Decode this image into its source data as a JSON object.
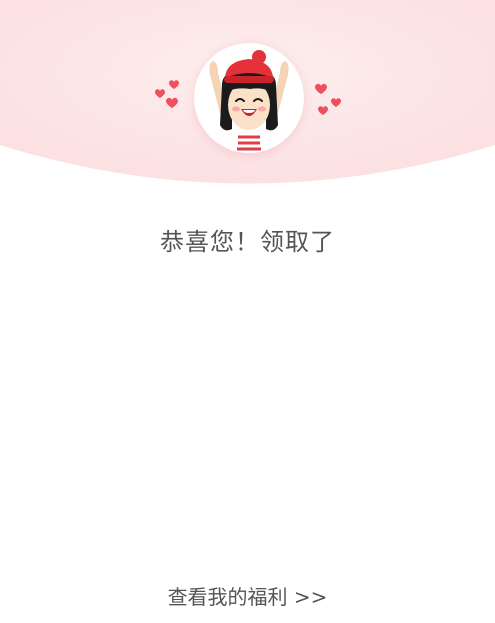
{
  "header": {
    "background_color": "#fde2e3",
    "avatar_icon": "cheering-girl-avatar",
    "decoration_icon": "hearts-icon",
    "heart_color": "#f0505e"
  },
  "main": {
    "title": "恭喜您！领取了"
  },
  "footer": {
    "view_benefits_label": "查看我的福利 >>"
  }
}
